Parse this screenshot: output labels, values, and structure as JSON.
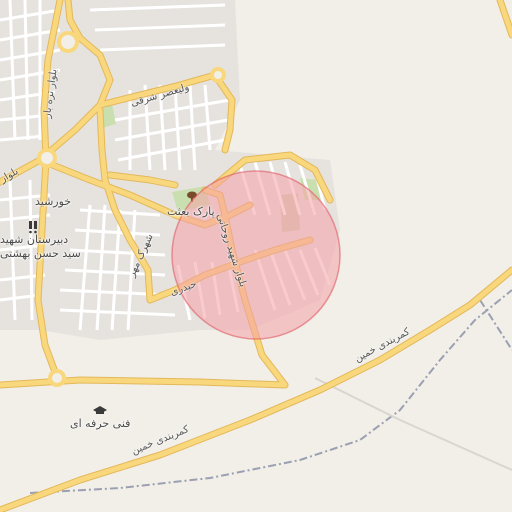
{
  "map": {
    "pois": {
      "park": "پارک بعثت",
      "khorshid": "خورشید",
      "school_line1": "دبیرستان شهید",
      "school_line2": "سید حسن بهشتی",
      "vocational": "فنی حرفه ای"
    },
    "roads": {
      "valiasr": "ولیعصر شرقی",
      "tarebar": "بلوار تره بار",
      "belvar": "بلوار",
      "shahid_ruhani": "بلوار شهید روحانی",
      "heidari": "حیدری",
      "shahrak": "شهرک مهر",
      "kamarbandi_upper": "کمربندی خمین",
      "kamarbandi_lower": "کمربندی خمین"
    },
    "icons": [
      "tree-icon",
      "school-icon",
      "graduation-cap-icon"
    ],
    "colors": {
      "background": "#f2efe9",
      "major_road": "#f9d77c",
      "minor_road": "#ffffff",
      "boundary": "#9aa0b0",
      "highlight_fill": "#f4a0a6",
      "highlight_stroke": "#e05c66",
      "park": "#c9dfb0"
    }
  }
}
